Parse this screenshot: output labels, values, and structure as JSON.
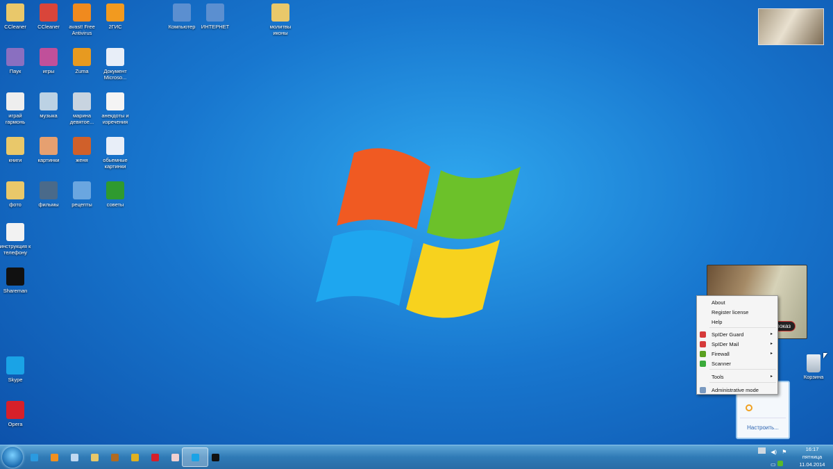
{
  "desktop_icons": [
    {
      "label": "CCleaner",
      "color": "#e9c86a"
    },
    {
      "label": "CCleaner",
      "color": "#d9453a"
    },
    {
      "label": "avast! Free Antivirus",
      "color": "#f08a1e"
    },
    {
      "label": "2ГИС",
      "color": "#f29a1f"
    },
    {
      "label": "Паук",
      "color": "#8a6fc0"
    },
    {
      "label": "игры",
      "color": "#c0509a"
    },
    {
      "label": "Zuma",
      "color": "#e79a20"
    },
    {
      "label": "Документ Microso...",
      "color": "#e8eef8"
    },
    {
      "label": "играй гармонь",
      "color": "#eeeeee"
    },
    {
      "label": "музыка",
      "color": "#bcd2e4"
    },
    {
      "label": "марина девятое...",
      "color": "#c8d4e0"
    },
    {
      "label": "анекдоты и изречения",
      "color": "#f4f4f4"
    },
    {
      "label": "книги",
      "color": "#e9c86a"
    },
    {
      "label": "картинки",
      "color": "#e6a070"
    },
    {
      "label": "женя",
      "color": "#d0602a"
    },
    {
      "label": "обьемные картинки",
      "color": "#e8eef8"
    },
    {
      "label": "фото",
      "color": "#e9c86a"
    },
    {
      "label": "фильмы",
      "color": "#4a6a8a"
    },
    {
      "label": "рецепты",
      "color": "#6aa6e0"
    },
    {
      "label": "советы",
      "color": "#2f9a2f"
    },
    {
      "label": "Компьютер",
      "color": "#5b8fd0"
    },
    {
      "label": "ИНТЕРНЕТ",
      "color": "#5b8fd0"
    },
    {
      "label": "молитвы иконы",
      "color": "#e9c86a"
    },
    {
      "label": "инструкция к телефону",
      "color": "#f2f2f2"
    },
    {
      "label": "Shareman",
      "color": "#111111"
    },
    {
      "label": "Skype",
      "color": "#1aa3e6"
    },
    {
      "label": "Opera",
      "color": "#d6202a"
    }
  ],
  "video_panel": {
    "button": "показ"
  },
  "context_menu": {
    "items": [
      {
        "label": "About"
      },
      {
        "label": "Register license"
      },
      {
        "label": "Help"
      },
      {
        "label": "SpIDer Guard",
        "submenu": true,
        "icon": "#d63a3a"
      },
      {
        "label": "SpIDer Mail",
        "submenu": true,
        "icon": "#d63a3a"
      },
      {
        "label": "Firewall",
        "submenu": true,
        "icon": "#5aa020"
      },
      {
        "label": "Scanner",
        "icon": "#3aaa3a"
      },
      {
        "label": "Tools",
        "submenu": true
      },
      {
        "label": "Administrative mode",
        "icon": "#7a9ac0"
      }
    ],
    "submenu_arrow": "▸"
  },
  "tray_popup": {
    "customize": "Настроить..."
  },
  "recycle_bin": {
    "label": "Корзина"
  },
  "taskbar": {
    "apps": [
      {
        "name": "internet-explorer",
        "color": "#2a9ae0"
      },
      {
        "name": "media-player",
        "color": "#f09020"
      },
      {
        "name": "app",
        "color": "#c0d8f0"
      },
      {
        "name": "explorer",
        "color": "#e9c86a"
      },
      {
        "name": "zuma",
        "color": "#b06a20"
      },
      {
        "name": "chrome",
        "color": "#e0b020"
      },
      {
        "name": "opera",
        "color": "#d6202a"
      },
      {
        "name": "pdf",
        "color": "#f0d0d0"
      },
      {
        "name": "skype",
        "color": "#1aa3e6",
        "active": true
      },
      {
        "name": "shareman",
        "color": "#111111"
      }
    ]
  },
  "clock": {
    "time": "16:17",
    "day": "пятница",
    "date": "11.04.2014"
  }
}
